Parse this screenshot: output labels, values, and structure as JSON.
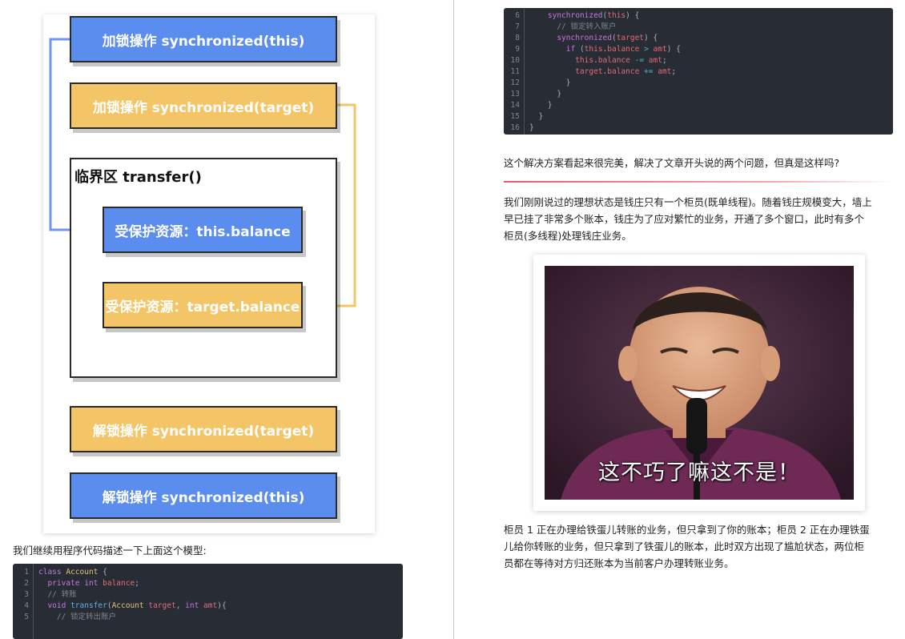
{
  "diagram": {
    "lock_this": "加锁操作 synchronized(this)",
    "lock_target": "加锁操作 synchronized(target)",
    "critical_section_title": "临界区 transfer()",
    "protected_this": "受保护资源：this.balance",
    "protected_target": "受保护资源：target.balance",
    "unlock_target": "解锁操作 synchronized(target)",
    "unlock_this": "解锁操作 synchronized(this)",
    "colors": {
      "blue": "#5b8def",
      "yellow": "#f3c566"
    }
  },
  "left": {
    "intro": "我们继续用程序代码描述一下上面这个模型:",
    "code_lines": [
      {
        "n": "1",
        "code": "class Account {"
      },
      {
        "n": "2",
        "code": "  private int balance;"
      },
      {
        "n": "3",
        "code": "  // 转账"
      },
      {
        "n": "4",
        "code": "  void transfer(Account target, int amt){"
      },
      {
        "n": "5",
        "code": "    // 锁定转出账户"
      }
    ]
  },
  "right": {
    "code_lines": [
      {
        "n": "6",
        "code": "    synchronized(this) {"
      },
      {
        "n": "7",
        "code": "      // 锁定转入账户"
      },
      {
        "n": "8",
        "code": "      synchronized(target) {"
      },
      {
        "n": "9",
        "code": "        if (this.balance > amt) {"
      },
      {
        "n": "10",
        "code": "          this.balance -= amt;"
      },
      {
        "n": "11",
        "code": "          target.balance += amt;"
      },
      {
        "n": "12",
        "code": "        }"
      },
      {
        "n": "13",
        "code": "      }"
      },
      {
        "n": "14",
        "code": "    }"
      },
      {
        "n": "15",
        "code": "  }"
      },
      {
        "n": "16",
        "code": "}"
      }
    ],
    "para1": "这个解决方案看起来很完美，解决了文章开头说的两个问题，但真是这样吗?",
    "para2_lines": [
      "我们刚刚说过的理想状态是钱庄只有一个柜员(既单线程)。随着钱庄规模变大，墙上",
      "早已挂了非常多个账本，钱庄为了应对繁忙的业务，开通了多个窗口，此时有多个",
      "柜员(多线程)处理钱庄业务。"
    ],
    "meme_caption": "这不巧了嘛这不是！",
    "para3_lines": [
      "柜员 1 正在办理给铁蛋儿转账的业务，但只拿到了你的账本；柜员 2 正在办理铁蛋",
      "儿给你转账的业务，但只拿到了铁蛋儿的账本，此时双方出现了尴尬状态，两位柜",
      "员都在等待对方归还账本为当前客户办理转账业务。"
    ]
  }
}
